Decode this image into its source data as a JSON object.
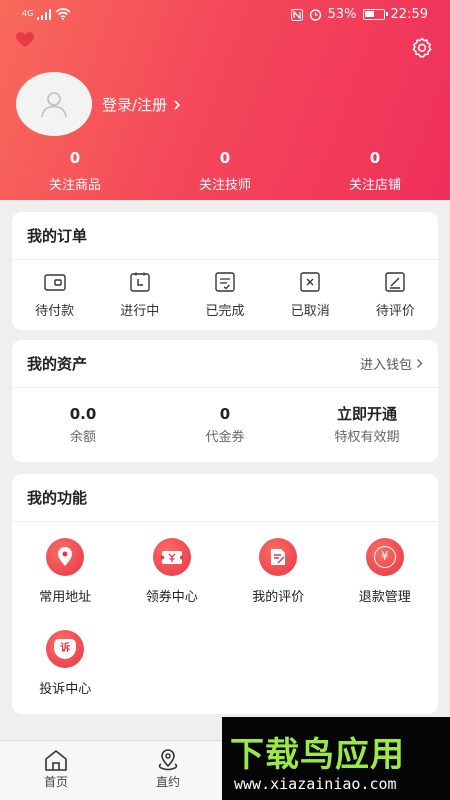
{
  "status_bar": {
    "signal_text": "4G",
    "battery_percent": "53%",
    "time": "22:59"
  },
  "profile": {
    "login_text": "登录/注册"
  },
  "follow_stats": [
    {
      "count": "0",
      "label": "关注商品"
    },
    {
      "count": "0",
      "label": "关注技师"
    },
    {
      "count": "0",
      "label": "关注店铺"
    }
  ],
  "orders": {
    "title": "我的订单",
    "items": [
      {
        "label": "待付款",
        "icon": "wallet-icon"
      },
      {
        "label": "进行中",
        "icon": "clock-icon"
      },
      {
        "label": "已完成",
        "icon": "check-list-icon"
      },
      {
        "label": "已取消",
        "icon": "cancel-icon"
      },
      {
        "label": "待评价",
        "icon": "edit-icon"
      }
    ]
  },
  "assets": {
    "title": "我的资产",
    "more_label": "进入钱包",
    "items": [
      {
        "value": "0.0",
        "label": "余额"
      },
      {
        "value": "0",
        "label": "代金券"
      },
      {
        "value": "立即开通",
        "label": "特权有效期"
      }
    ]
  },
  "functions": {
    "title": "我的功能",
    "items": [
      {
        "label": "常用地址",
        "icon": "location-pin-icon"
      },
      {
        "label": "领券中心",
        "icon": "coupon-icon"
      },
      {
        "label": "我的评价",
        "icon": "review-icon"
      },
      {
        "label": "退款管理",
        "icon": "refund-icon"
      },
      {
        "label": "投诉中心",
        "icon": "complaint-icon",
        "badge": "诉"
      }
    ]
  },
  "refund_symbol": "¥",
  "tabbar": [
    {
      "label": "首页",
      "icon": "home-icon"
    },
    {
      "label": "直约",
      "icon": "location-icon"
    }
  ],
  "watermark": {
    "main": "下载鸟应用",
    "url": "www.xiazainiao.com"
  },
  "colors": {
    "header_start": "#f86a5a",
    "header_end": "#ef2f5a",
    "accent": "#e8334a"
  }
}
